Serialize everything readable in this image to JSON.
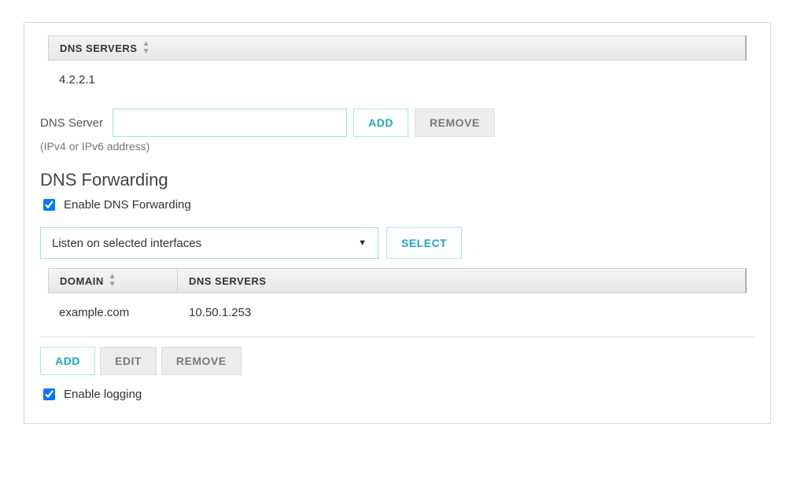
{
  "dnsServers": {
    "header": "DNS SERVERS",
    "rows": [
      {
        "server": "4.2.2.1"
      }
    ]
  },
  "dnsInput": {
    "label": "DNS Server",
    "value": "",
    "hint": "(IPv4 or IPv6 address)",
    "addBtn": "ADD",
    "removeBtn": "REMOVE"
  },
  "forwarding": {
    "title": "DNS Forwarding",
    "enableLabel": "Enable DNS Forwarding",
    "enableChecked": true,
    "listenMode": "Listen on selected interfaces",
    "selectBtn": "SELECT"
  },
  "forwardTable": {
    "headers": {
      "domain": "DOMAIN",
      "servers": "DNS SERVERS"
    },
    "rows": [
      {
        "domain": "example.com",
        "servers": "10.50.1.253"
      }
    ],
    "addBtn": "ADD",
    "editBtn": "EDIT",
    "removeBtn": "REMOVE"
  },
  "logging": {
    "label": "Enable logging",
    "checked": true
  }
}
